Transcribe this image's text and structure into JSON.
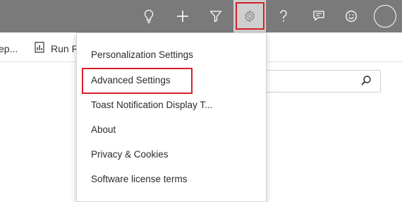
{
  "topbar": {
    "icons": [
      "lightbulb-icon",
      "plus-icon",
      "filter-icon",
      "gear-icon",
      "help-icon",
      "feedback-icon",
      "smiley-icon",
      "avatar-icon"
    ],
    "background": "#7a7a7a",
    "highlight_color": "#d6202a"
  },
  "commandbar": {
    "item_left_text": "ep...",
    "run_report_label": "Run R"
  },
  "settings_menu": {
    "items": [
      "Personalization Settings",
      "Advanced Settings",
      "Toast Notification Display T...",
      "About",
      "Privacy & Cookies",
      "Software license terms"
    ]
  }
}
